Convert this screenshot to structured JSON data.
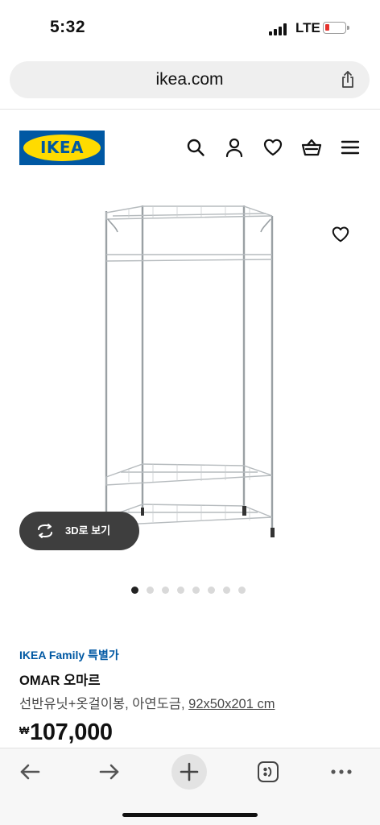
{
  "status_bar": {
    "time": "5:32",
    "network": "LTE"
  },
  "browser": {
    "url": "ikea.com"
  },
  "header": {
    "logo_text": "IKEA",
    "icons": [
      "search-icon",
      "user-icon",
      "heart-icon",
      "basket-icon",
      "menu-icon"
    ]
  },
  "product": {
    "view_3d_label": "3D로 보기",
    "gallery": {
      "image_count": 8,
      "active_index": 0
    },
    "family_price_label": "IKEA Family 특별가",
    "name": "OMAR 오마르",
    "description": "선반유닛+옷걸이봉, 아연도금,",
    "size": "92x50x201 cm",
    "currency_symbol": "₩",
    "price": "107,000"
  },
  "colors": {
    "ikea_blue": "#0058a3",
    "ikea_yellow": "#ffdb00",
    "battery_low": "#e5322d"
  },
  "toolbar": {
    "icons": [
      "back-arrow-icon",
      "forward-arrow-icon",
      "new-tab-plus-icon",
      "tabs-icon",
      "more-icon"
    ]
  }
}
